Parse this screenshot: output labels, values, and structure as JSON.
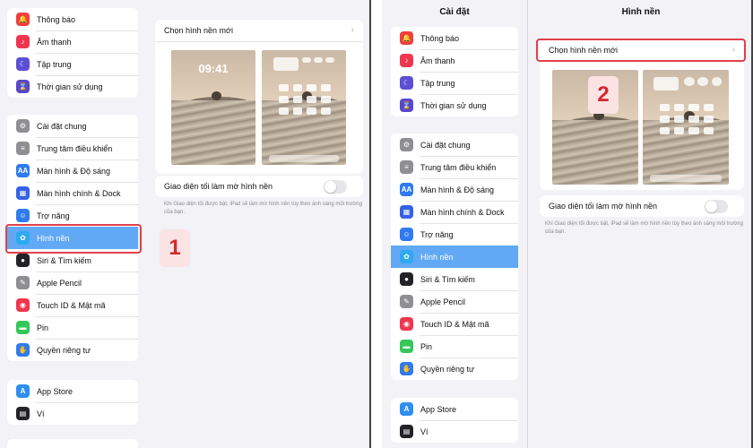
{
  "colors": {
    "selected": "#61a9f4",
    "highlight": "#e0404a",
    "badge_text": "#d3282f",
    "badge_bg": "#fbe3e3"
  },
  "left": {
    "sidebar": {
      "groups": [
        [
          {
            "label": "Thông báo",
            "icon": "bell-icon",
            "color": "#f03e3e"
          },
          {
            "label": "Âm thanh",
            "icon": "speaker-icon",
            "color": "#f0364f"
          },
          {
            "label": "Tập trung",
            "icon": "moon-icon",
            "color": "#5c4fd6"
          },
          {
            "label": "Thời gian sử dụng",
            "icon": "hourglass-icon",
            "color": "#5a47c9"
          }
        ],
        [
          {
            "label": "Cài đặt chung",
            "icon": "gear-icon",
            "color": "#8e8e93"
          },
          {
            "label": "Trung tâm điều khiển",
            "icon": "switches-icon",
            "color": "#8e8e93"
          },
          {
            "label": "Màn hình & Độ sáng",
            "icon": "text-size-icon",
            "color": "#2f7bf0"
          },
          {
            "label": "Màn hình chính & Dock",
            "icon": "grid-icon",
            "color": "#3561e8"
          },
          {
            "label": "Trợ năng",
            "icon": "accessibility-icon",
            "color": "#2f7bf0"
          },
          {
            "label": "Hình nền",
            "icon": "flower-icon",
            "color": "#2ea9f0",
            "selected": true
          },
          {
            "label": "Siri & Tìm kiếm",
            "icon": "siri-icon",
            "color": "#222228"
          },
          {
            "label": "Apple Pencil",
            "icon": "pencil-icon",
            "color": "#8e8e93"
          },
          {
            "label": "Touch ID & Mật mã",
            "icon": "fingerprint-icon",
            "color": "#f0364f"
          },
          {
            "label": "Pin",
            "icon": "battery-icon",
            "color": "#34c759"
          },
          {
            "label": "Quyền riêng tư",
            "icon": "hand-icon",
            "color": "#2f7bf0"
          }
        ],
        [
          {
            "label": "App Store",
            "icon": "app-store-icon",
            "color": "#2f8ff0"
          },
          {
            "label": "Ví",
            "icon": "wallet-icon",
            "color": "#222228"
          }
        ]
      ]
    },
    "content": {
      "choose_label": "Chọn hình nền mới",
      "lock_time": "09:41",
      "dark_toggle_label": "Giao diện tối làm mờ hình nền",
      "dark_toggle_on": false,
      "description": "Khi Giao diện tối được bật, iPad sẽ làm mờ hình nền tùy theo ánh sáng môi trường của bạn."
    },
    "step_badge": "1"
  },
  "right": {
    "sidebar_title": "Cài đặt",
    "content_title": "Hình nền",
    "content": {
      "choose_label": "Chọn hình nền mới",
      "dark_toggle_label": "Giao diện tối làm mờ hình nền",
      "dark_toggle_on": false,
      "description": "Khi Giao diện tối được bật, iPad sẽ làm mờ hình nền tùy theo ánh sáng môi trường của bạn."
    },
    "step_badge": "2"
  }
}
